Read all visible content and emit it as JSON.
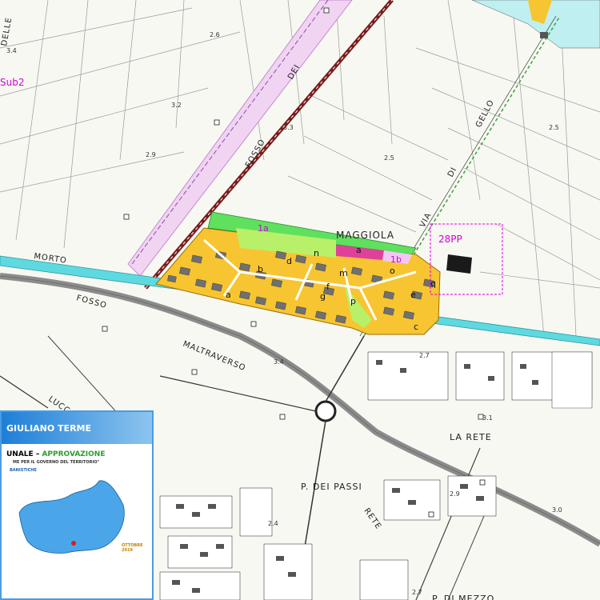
{
  "labels": {
    "street_morto": "MORTO",
    "street_fosso": "FOSSO",
    "street_dei": "DEI",
    "street_lucca": "LUCCA",
    "street_maltraverso": "MALTRAVERSO",
    "street_via": "VIA",
    "street_di": "DI",
    "street_gello": "GELLO",
    "street_rete_south": "RETE",
    "place_maggiola": "MAGGIOLA",
    "place_la_rete": "LA RETE",
    "place_p_dei_passi": "P. DEI PASSI",
    "place_p_di_mezzo": "P. DI MEZZO",
    "place_delle": "DELLE",
    "place_fosso_2": "FOSSO",
    "zone_1a": "1a",
    "zone_1b": "1b",
    "zone_28pp": "28PP",
    "zone_sub2": "Sub2",
    "zone_a": "a",
    "zone_a2": "a",
    "zone_b": "b",
    "zone_c": "c",
    "zone_d": "d",
    "zone_e": "e",
    "zone_f": "f",
    "zone_g": "g",
    "zone_m": "m",
    "zone_n": "n",
    "zone_o": "o",
    "zone_p": "p",
    "zone_q": "q",
    "elev_1": "2.6",
    "elev_2": "3.4",
    "elev_3": "3.2",
    "elev_4": "2.9",
    "elev_5": "2.5",
    "elev_6": "2.5",
    "elev_7": "3.4",
    "elev_8": "2.7",
    "elev_9": "3.1",
    "elev_10": "2.9",
    "elev_11": "3.0",
    "elev_12": "2.4",
    "elev_13": "2.7",
    "elev_14": "3.3"
  },
  "legend": {
    "title": "GIULIANO TERME",
    "line1_prefix": "UNALE –",
    "line1_status": "APPROVAZIONE",
    "line2": "ME PER IL GOVERNO DEL TERRITORIO\"",
    "line3": "BANISTICHE",
    "date": "OTTOBRE 2019"
  },
  "colors": {
    "residential": "#f7c531",
    "green_area": "#5fe05f",
    "light_green": "#b8f06a",
    "pink_zone": "#e0409a",
    "light_pink": "#f2c8f2",
    "canal": "#5fd9e0",
    "railway": "#7a1c1c",
    "road_gray": "#8c8c8c",
    "magenta_label": "#d400d4",
    "legend_blue": "#1d7fd8"
  }
}
